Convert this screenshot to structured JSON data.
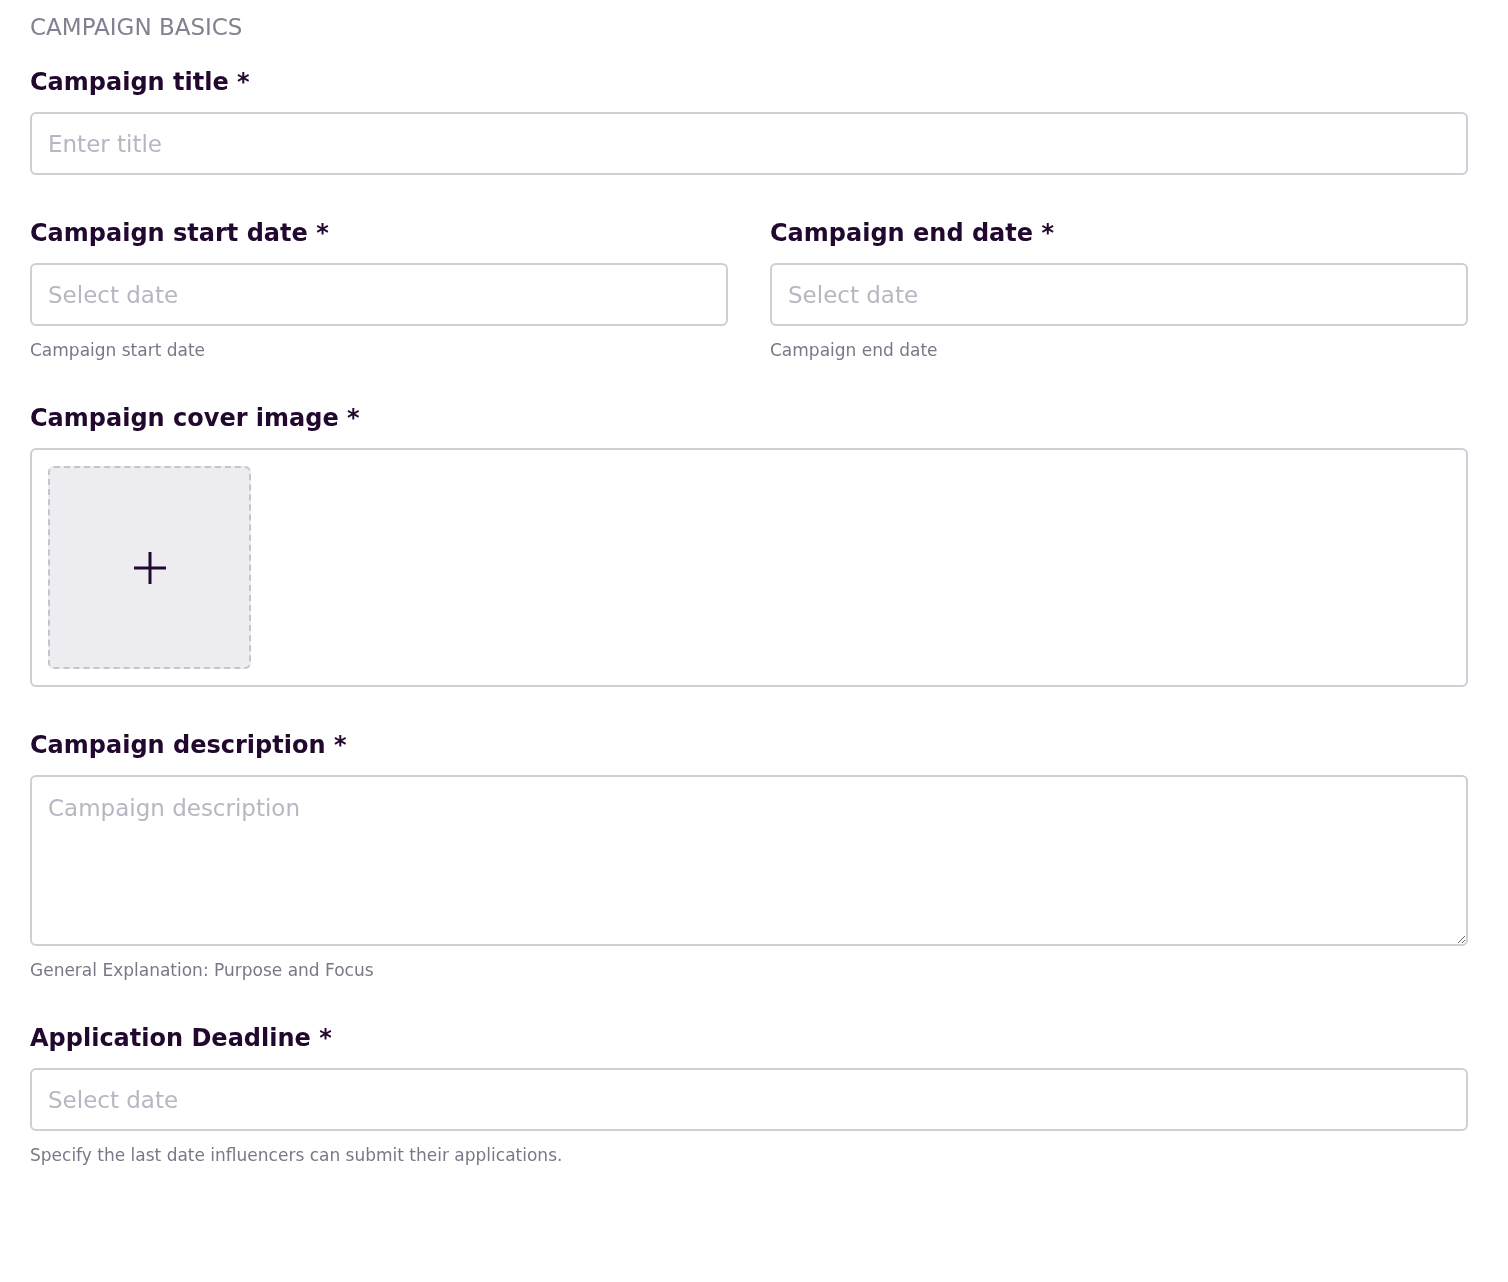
{
  "section_title": "CAMPAIGN BASICS",
  "rows": [
    {
      "fields": [
        {
          "kind": "text",
          "label": "Campaign title *",
          "placeholder": "Enter title"
        }
      ]
    },
    {
      "fields": [
        {
          "kind": "date",
          "label": "Campaign start date *",
          "placeholder": "Select date",
          "help": "Campaign start date"
        },
        {
          "kind": "date",
          "label": "Campaign end date *",
          "placeholder": "Select date",
          "help": "Campaign end date"
        }
      ]
    },
    {
      "fields": [
        {
          "kind": "image",
          "label": "Campaign cover image *"
        }
      ]
    },
    {
      "fields": [
        {
          "kind": "textarea",
          "label": "Campaign description *",
          "placeholder": "Campaign description",
          "help": "General Explanation: Purpose and Focus"
        }
      ]
    },
    {
      "fields": [
        {
          "kind": "date",
          "label": "Application Deadline *",
          "placeholder": "Select date",
          "help": "Specify the last date influencers can submit their applications."
        }
      ]
    }
  ]
}
